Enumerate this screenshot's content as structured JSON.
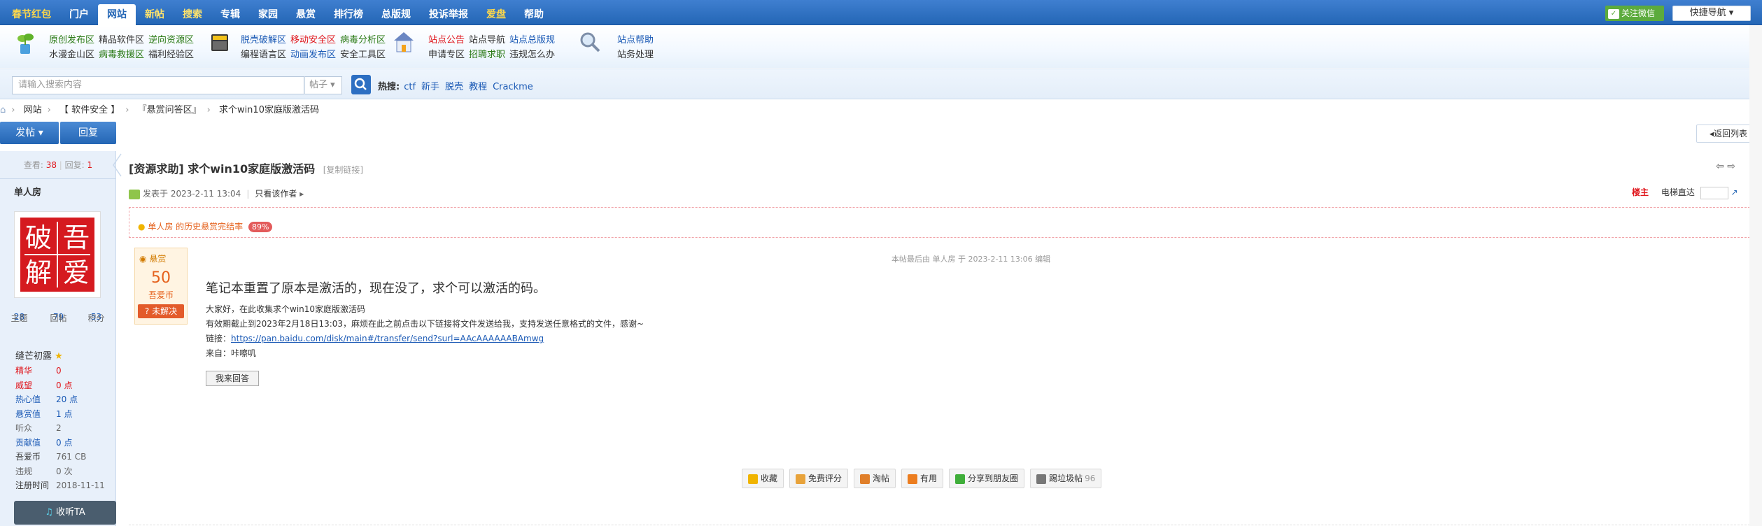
{
  "topnav": {
    "items": [
      "春节红包",
      "门户",
      "网站",
      "新帖",
      "搜索",
      "专辑",
      "家园",
      "悬赏",
      "排行榜",
      "总版规",
      "投诉举报",
      "爱盘",
      "帮助"
    ],
    "active_index": 2,
    "follow_wechat": "关注微信",
    "quick_nav": "快捷导航"
  },
  "forums": {
    "group1": {
      "row1": [
        "原创发布区",
        "精品软件区",
        "逆向资源区"
      ],
      "row2": [
        "水漫金山区",
        "病毒救援区",
        "福利经验区"
      ]
    },
    "group2": {
      "row1": [
        "脱壳破解区",
        "移动安全区",
        "病毒分析区"
      ],
      "row2": [
        "编程语言区",
        "动画发布区",
        "安全工具区"
      ]
    },
    "group3": {
      "row1": [
        "站点公告",
        "站点导航",
        "站点总版规"
      ],
      "row2": [
        "申请专区",
        "招聘求职",
        "违规怎么办"
      ]
    },
    "group4": {
      "row1": [
        "站点帮助"
      ],
      "row2": [
        "站务处理"
      ]
    }
  },
  "search": {
    "placeholder": "请输入搜索内容",
    "type": "帖子",
    "hot_label": "热搜:",
    "hot_terms": [
      "ctf",
      "新手",
      "脱壳",
      "教程",
      "Crackme"
    ]
  },
  "breadcrumb": [
    "网站",
    "【 软件安全 】",
    "『悬赏问答区』",
    "求个win10家庭版激活码"
  ],
  "buttons": {
    "post": "发帖",
    "reply": "回复",
    "back": "返回列表"
  },
  "thread_stats": {
    "views_label": "查看:",
    "views": "38",
    "replies_label": "回复:",
    "replies": "1"
  },
  "author": {
    "name": "单人房",
    "avatar_text": [
      "破",
      "吾",
      "解",
      "爱"
    ],
    "stats": [
      {
        "value": "28",
        "label": "主题"
      },
      {
        "value": "79",
        "label": "回帖"
      },
      {
        "value": "53",
        "label": "积分"
      }
    ],
    "rank": "缝芒初露",
    "info": [
      {
        "k": "精华",
        "v": "0"
      },
      {
        "k": "威望",
        "v": "0 点"
      },
      {
        "k": "热心值",
        "v": "20 点"
      },
      {
        "k": "悬赏值",
        "v": "1 点"
      },
      {
        "k": "听众",
        "v": "2"
      },
      {
        "k": "贡献值",
        "v": "0 点"
      },
      {
        "k": "吾爱币",
        "v": "761 CB"
      },
      {
        "k": "违规",
        "v": "0 次"
      },
      {
        "k": "注册时间",
        "v": "2018-11-11"
      }
    ],
    "listen": "收听TA"
  },
  "post": {
    "tag": "[资源求助]",
    "title": "求个win10家庭版激活码",
    "copy_link": "[复制链接]",
    "posted": "发表于 2023-2-11 13:04",
    "only_author": "只看该作者",
    "host": "楼主",
    "elevator": "电梯直达",
    "reward_history": "单人房 的历史悬赏完结率",
    "reward_rate": "89%",
    "bounty_title": "悬赏",
    "bounty_amount": "50",
    "bounty_unit": "吾爱币",
    "bounty_status": "未解决",
    "last_edit": "本帖最后由 单人房 于 2023-2-11 13:06 编辑",
    "heading": "笔记本重置了原本是激活的，现在没了，求个可以激活的码。",
    "line1": "大家好，在此收集求个win10家庭版激活码",
    "line2": "有效期截止到2023年2月18日13:03，麻烦在此之前点击以下链接将文件发送给我，支持发送任意格式的文件，感谢~",
    "link_label": "链接：",
    "link": "https://pan.baidu.com/disk/main#/transfer/send?surl=AAcAAAAAABAmwg",
    "source": "来自：咔嚓叽",
    "answer_btn": "我来回答"
  },
  "actions": [
    {
      "label": "收藏",
      "color": "#f0b400"
    },
    {
      "label": "免费评分",
      "color": "#e8a33b"
    },
    {
      "label": "淘帖",
      "color": "#e07f2a"
    },
    {
      "label": "有用",
      "color": "#ec7d1f"
    },
    {
      "label": "分享到朋友圈",
      "color": "#3fae3a"
    },
    {
      "label": "踢垃圾帖",
      "color": "#777777",
      "count": "96"
    }
  ]
}
